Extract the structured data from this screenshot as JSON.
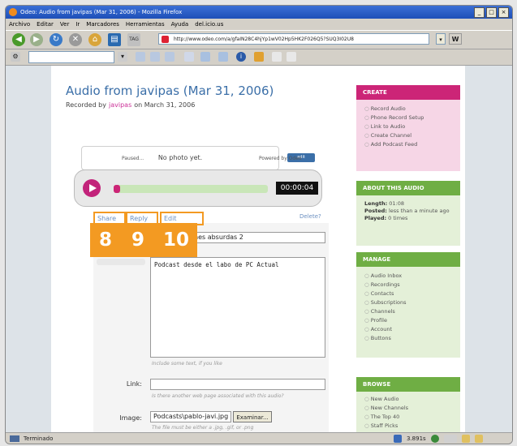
{
  "window": {
    "title": "Odeo: Audio from javipas (Mar 31, 2006) - Mozilla Firefox"
  },
  "menu": [
    "Archivo",
    "Editar",
    "Ver",
    "Ir",
    "Marcadores",
    "Herramientas",
    "Ayuda",
    "del.icio.us"
  ],
  "address": {
    "url": "http://www.odeo.com/a/gfaIN28C4hjYp1wV02Hp5HK2F026Q5?SUQ3I02U8",
    "tag_label": "TAG"
  },
  "page": {
    "title": "Audio from javipas (Mar 31, 2006)",
    "recorded_prefix": "Recorded by",
    "recorded_user": "javipas",
    "recorded_suffix": "on March 31, 2006",
    "no_photo": "No photo yet.",
    "photo_button": "edit"
  },
  "player": {
    "time": "00:00:04",
    "status": "Paused...",
    "powered_by": "Powered by Odeo",
    "progress": 0.04
  },
  "actions": {
    "share": "Share",
    "reply": "Reply",
    "edit": "Edit",
    "delete": "Delete?"
  },
  "badges": [
    "8",
    "9",
    "10"
  ],
  "form": {
    "title_value": "nes absurdas 2",
    "description_value": "Podcast desde el labo de PC Actual",
    "description_hint": "Include some text, if you like",
    "link_label": "Link:",
    "link_value": "",
    "link_hint": "Is there another web page associated with this audio?",
    "image_label": "Image:",
    "image_value": "Podcasts\\pablo-javi.jpg",
    "image_button": "Examinar...",
    "image_hint": "The file must be either a .jpg, .gif, or .png"
  },
  "sidebar": {
    "create": {
      "header": "CREATE",
      "items": [
        "Record Audio",
        "Phone Record Setup",
        "Link to Audio",
        "Create Channel",
        "Add Podcast Feed"
      ]
    },
    "about": {
      "header": "ABOUT THIS AUDIO",
      "length_label": "Length:",
      "length_value": "01:08",
      "posted_label": "Posted:",
      "posted_value": "less than a minute ago",
      "played_label": "Played:",
      "played_value": "0 times"
    },
    "manage": {
      "header": "MANAGE",
      "items": [
        "Audio Inbox",
        "Recordings",
        "Contacts",
        "Subscriptions",
        "Channels",
        "Profile",
        "Account",
        "Buttons"
      ]
    },
    "browse": {
      "header": "BROWSE",
      "items": [
        "New Audio",
        "New Channels",
        "The Top 40",
        "Staff Picks"
      ]
    }
  },
  "statusbar": {
    "text": "Terminado",
    "speed": "3.891s"
  },
  "colors": {
    "brand_pink": "#cc2577",
    "sidebar_green": "#6fae44",
    "sidebar_pink": "#cc2577",
    "badge_orange": "#f39a22",
    "title_blue": "#3b6fa8"
  }
}
